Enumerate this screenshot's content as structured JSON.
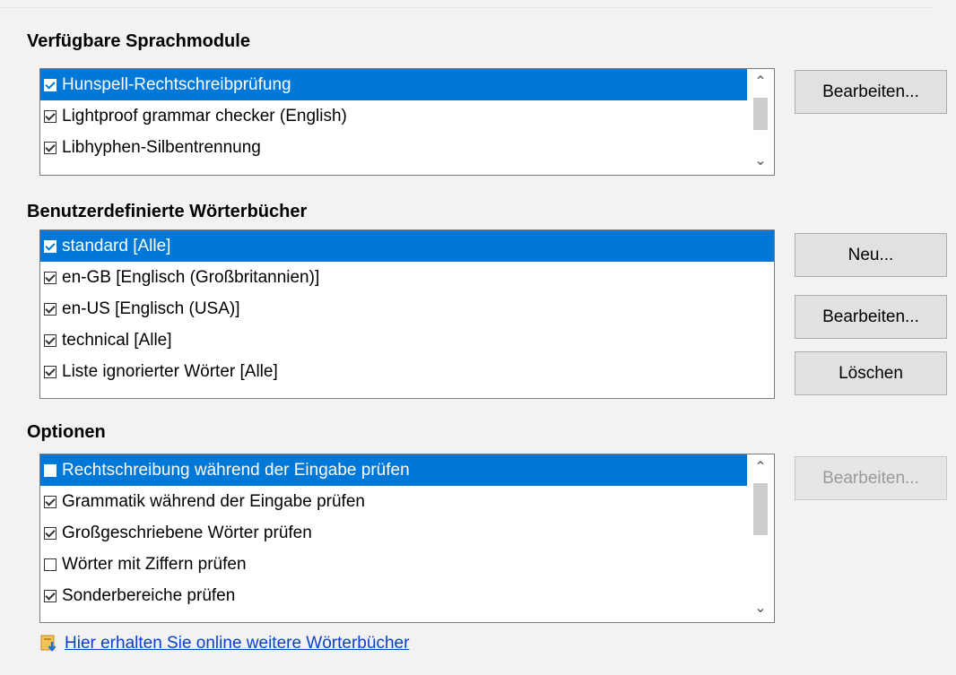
{
  "sections": {
    "modules_title": "Verfügbare Sprachmodule",
    "dictionaries_title": "Benutzerdefinierte Wörterbücher",
    "options_title": "Optionen"
  },
  "modules": [
    {
      "label": "Hunspell-Rechtschreibprüfung",
      "checked": true,
      "selected": true
    },
    {
      "label": "Lightproof grammar checker (English)",
      "checked": true,
      "selected": false
    },
    {
      "label": "Libhyphen-Silbentrennung",
      "checked": true,
      "selected": false
    }
  ],
  "dictionaries": [
    {
      "label": "standard [Alle]",
      "checked": true,
      "selected": true
    },
    {
      "label": "en-GB [Englisch (Großbritannien)]",
      "checked": true,
      "selected": false
    },
    {
      "label": "en-US [Englisch (USA)]",
      "checked": true,
      "selected": false
    },
    {
      "label": "technical [Alle]",
      "checked": true,
      "selected": false
    },
    {
      "label": "Liste ignorierter Wörter [Alle]",
      "checked": true,
      "selected": false
    }
  ],
  "options": [
    {
      "label": "Rechtschreibung während der Eingabe prüfen",
      "checked": false,
      "selected": true
    },
    {
      "label": "Grammatik während der Eingabe prüfen",
      "checked": true,
      "selected": false
    },
    {
      "label": "Großgeschriebene Wörter prüfen",
      "checked": true,
      "selected": false
    },
    {
      "label": "Wörter mit Ziffern prüfen",
      "checked": false,
      "selected": false
    },
    {
      "label": "Sonderbereiche prüfen",
      "checked": true,
      "selected": false
    }
  ],
  "buttons": {
    "modules_edit": "Bearbeiten...",
    "dict_new": "Neu...",
    "dict_edit": "Bearbeiten...",
    "dict_delete": "Löschen",
    "options_edit": "Bearbeiten..."
  },
  "link": {
    "text": "Hier erhalten Sie online weitere Wörterbücher",
    "icon": "download-icon"
  },
  "colors": {
    "selection": "#0078d7",
    "link": "#0a3dd6"
  }
}
